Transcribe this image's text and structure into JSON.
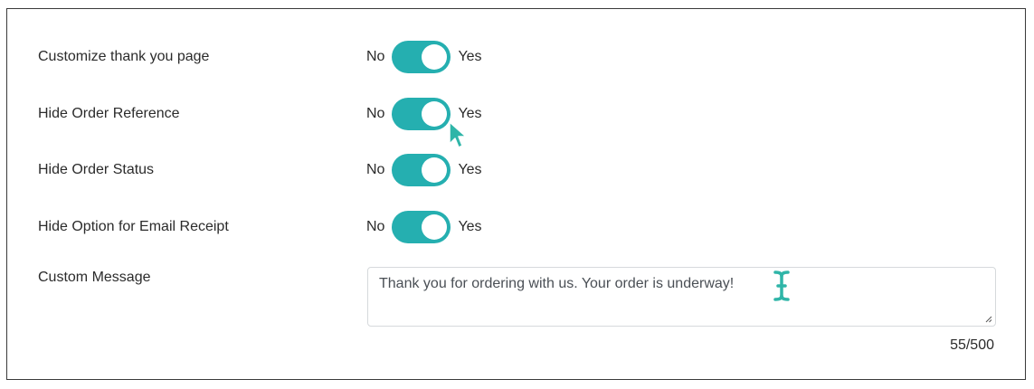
{
  "settings": [
    {
      "label": "Customize thank you page",
      "off_label": "No",
      "on_label": "Yes",
      "enabled": true
    },
    {
      "label": "Hide Order Reference",
      "off_label": "No",
      "on_label": "Yes",
      "enabled": true
    },
    {
      "label": "Hide Order Status",
      "off_label": "No",
      "on_label": "Yes",
      "enabled": true
    },
    {
      "label": "Hide Option for Email Receipt",
      "off_label": "No",
      "on_label": "Yes",
      "enabled": true
    }
  ],
  "custom_message": {
    "label": "Custom Message",
    "value": "Thank you for ordering with us. Your order is underway!",
    "counter": "55/500"
  },
  "colors": {
    "toggle_on": "#25afb0",
    "cursor": "#2fb5a8"
  },
  "icons": {
    "pointer": "mouse-pointer-icon",
    "text_cursor": "text-cursor-icon",
    "resize": "resize-grip-icon"
  }
}
